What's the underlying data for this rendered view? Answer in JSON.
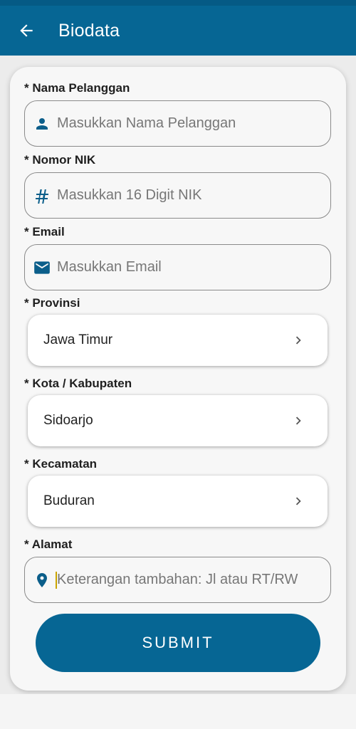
{
  "header": {
    "title": "Biodata"
  },
  "form": {
    "nama": {
      "label": "* Nama Pelanggan",
      "placeholder": "Masukkan Nama Pelanggan"
    },
    "nik": {
      "label": "* Nomor NIK",
      "placeholder": "Masukkan 16 Digit NIK"
    },
    "email": {
      "label": "* Email",
      "placeholder": "Masukkan Email"
    },
    "provinsi": {
      "label": "* Provinsi",
      "value": "Jawa Timur"
    },
    "kota": {
      "label": "* Kota / Kabupaten",
      "value": "Sidoarjo"
    },
    "kecamatan": {
      "label": "* Kecamatan",
      "value": "Buduran"
    },
    "alamat": {
      "label": "* Alamat",
      "placeholder": "Keterangan tambahan: Jl atau RT/RW"
    },
    "submit_label": "SUBMIT"
  },
  "colors": {
    "primary": "#066694",
    "icon": "#0b5e8a"
  },
  "icons": [
    "back-arrow",
    "person",
    "hash",
    "mail",
    "chevron-right",
    "location-pin"
  ]
}
